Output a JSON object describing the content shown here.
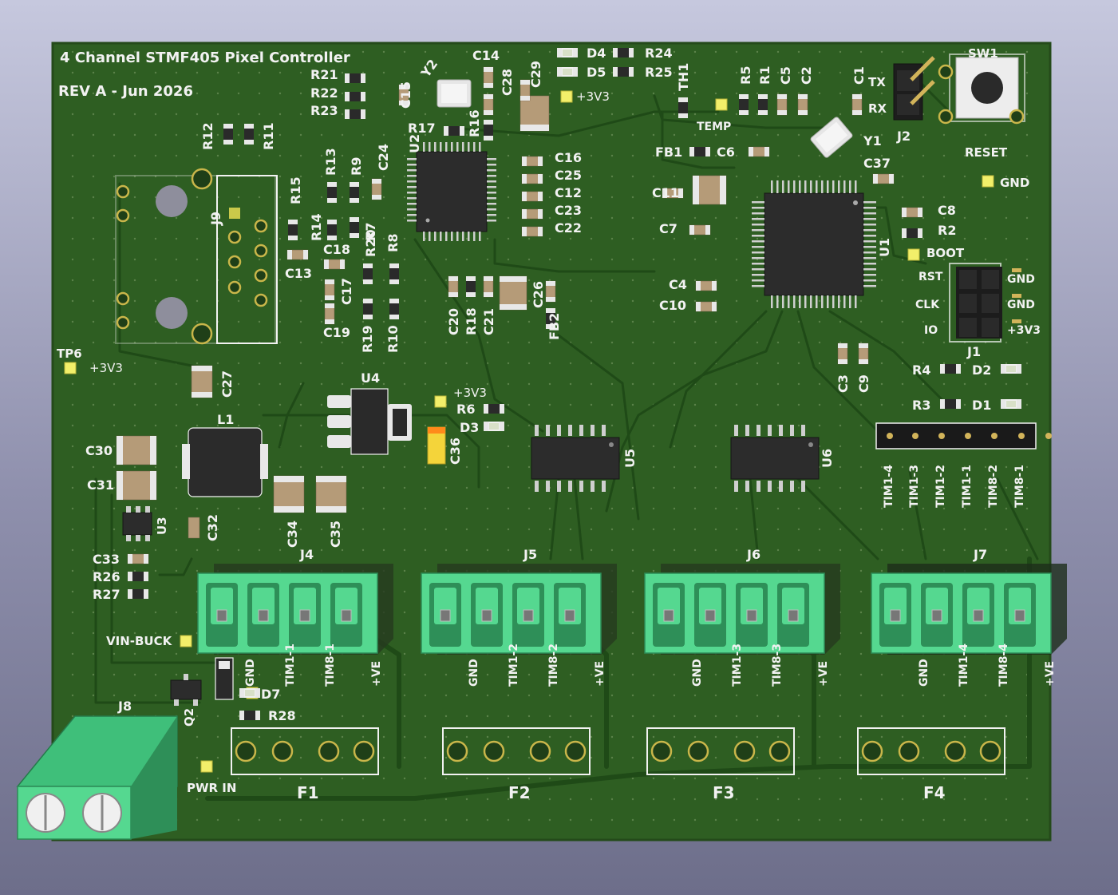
{
  "board": {
    "title": "4 Channel STMF405 Pixel Controller",
    "revision": "REV A - Jun 2026",
    "colors": {
      "background_top": "#c6c8de",
      "pcb": "#2e5e22",
      "silkscreen": "#f2f2f2",
      "copper_pad": "#c9c94a",
      "terminal": "#55d890"
    }
  },
  "labels": {
    "sw1": "SW1",
    "reset": "RESET",
    "tx": "TX",
    "rx": "RX",
    "j2": "J2",
    "gnd": "GND",
    "boot": "BOOT",
    "temp": "TEMP",
    "th1": "TH1",
    "plus3v3": "+3V3",
    "tp6": "TP6",
    "vin_buck": "VIN-BUCK",
    "pwr_in": "PWR IN",
    "j1": "J1",
    "j1_rst": "RST",
    "j1_clk": "CLK",
    "j1_io": "IO",
    "j1_gnd1": "GND",
    "j1_gnd2": "GND",
    "j1_3v3": "+3V3",
    "u1": "U1",
    "u2": "U2",
    "u3": "U3",
    "u4": "U4",
    "u5": "U5",
    "u6": "U6",
    "y1": "Y1",
    "y2": "Y2",
    "l1": "L1",
    "j9": "J9",
    "j8": "J8",
    "q2": "Q2",
    "d1": "D1",
    "d2": "D2",
    "d3": "D3",
    "d4": "D4",
    "d5": "D5",
    "d7": "D7",
    "fb1": "FB1",
    "fb2": "FB2",
    "r2": "R2",
    "r3": "R3",
    "r4": "R4",
    "r5": "R5",
    "r1": "R1",
    "r6": "R6",
    "r7": "R7",
    "r8": "R8",
    "r9": "R9",
    "r10": "R10",
    "r11": "R11",
    "r12": "R12",
    "r13": "R13",
    "r14": "R14",
    "r15": "R15",
    "r16": "R16",
    "r17": "R17",
    "r18": "R18",
    "r19": "R19",
    "r20": "R20",
    "r21": "R21",
    "r22": "R22",
    "r23": "R23",
    "r24": "R24",
    "r25": "R25",
    "r26": "R26",
    "r27": "R27",
    "r28": "R28",
    "c1": "C1",
    "c2": "C2",
    "c3": "C3",
    "c4": "C4",
    "c5": "C5",
    "c6": "C6",
    "c7": "C7",
    "c8": "C8",
    "c9": "C9",
    "c10": "C10",
    "c11": "C11",
    "c12": "C12",
    "c13": "C13",
    "c14": "C14",
    "c15": "C15",
    "c16": "C16",
    "c17": "C17",
    "c18": "C18",
    "c19": "C19",
    "c20": "C20",
    "c21": "C21",
    "c22": "C22",
    "c23": "C23",
    "c24": "C24",
    "c25": "C25",
    "c26": "C26",
    "c27": "C27",
    "c28": "C28",
    "c29": "C29",
    "c30": "C30",
    "c31": "C31",
    "c32": "C32",
    "c33": "C33",
    "c34": "C34",
    "c35": "C35",
    "c36": "C36",
    "c37": "C37"
  },
  "timer_header": [
    "TIM1-4",
    "TIM1-3",
    "TIM1-2",
    "TIM1-1",
    "TIM8-2",
    "TIM8-1"
  ],
  "connectors": [
    {
      "ref": "J4",
      "fuse": "F1",
      "pins": [
        "GND",
        "TIM1-1",
        "TIM8-1",
        "+VE"
      ]
    },
    {
      "ref": "J5",
      "fuse": "F2",
      "pins": [
        "GND",
        "TIM1-2",
        "TIM8-2",
        "+VE"
      ]
    },
    {
      "ref": "J6",
      "fuse": "F3",
      "pins": [
        "GND",
        "TIM1-3",
        "TIM8-3",
        "+VE"
      ]
    },
    {
      "ref": "J7",
      "fuse": "F4",
      "pins": [
        "GND",
        "TIM1-4",
        "TIM8-4",
        "+VE"
      ]
    }
  ]
}
